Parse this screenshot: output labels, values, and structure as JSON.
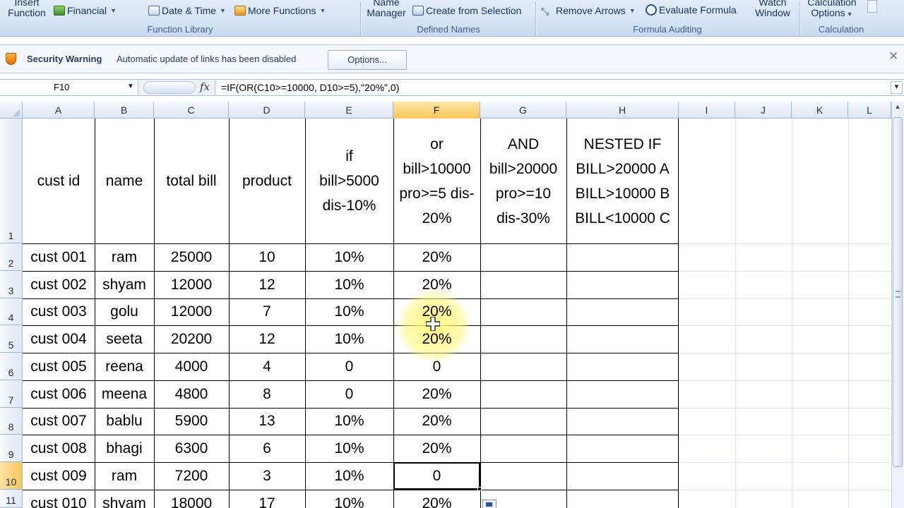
{
  "ribbon": {
    "insert_function": [
      "Insert",
      "Function"
    ],
    "financial": "Financial",
    "date_time": "Date & Time",
    "more_functions": "More Functions",
    "function_library": "Function Library",
    "name_manager": [
      "Name",
      "Manager"
    ],
    "create_from_selection": "Create from Selection",
    "defined_names": "Defined Names",
    "remove_arrows": "Remove Arrows",
    "evaluate_formula": "Evaluate Formula",
    "watch_window": [
      "Watch",
      "Window"
    ],
    "formula_auditing": "Formula Auditing",
    "calculation_options": [
      "Calculation",
      "Options"
    ],
    "calculation": "Calculation"
  },
  "security_bar": {
    "title": "Security Warning",
    "message": "Automatic update of links has been disabled",
    "options_button": "Options..."
  },
  "formula_bar": {
    "name_box": "F10",
    "fx": "fx",
    "formula": "=IF(OR(C10>=10000, D10>=5),\"20%\",0)"
  },
  "columns": [
    "A",
    "B",
    "C",
    "D",
    "E",
    "F",
    "G",
    "H",
    "I",
    "J",
    "K",
    "L"
  ],
  "selected_column": "F",
  "rows": [
    "1",
    "2",
    "3",
    "4",
    "5",
    "6",
    "7",
    "8",
    "9",
    "10",
    "11"
  ],
  "selected_row": "10",
  "header_row": {
    "A": [
      "cust id"
    ],
    "B": [
      "name"
    ],
    "C": [
      "total bill"
    ],
    "D": [
      "product"
    ],
    "E": [
      "if",
      "bill>5000",
      "dis-10%"
    ],
    "F": [
      "or",
      "bill>10000",
      "pro>=5 dis-",
      "20%"
    ],
    "G": [
      "AND",
      "bill>20000",
      "pro>=10",
      "dis-30%"
    ],
    "H": [
      "NESTED IF",
      "BILL>20000 A",
      "BILL>10000 B",
      "BILL<10000 C"
    ]
  },
  "table": [
    [
      "cust 001",
      "ram",
      "25000",
      "10",
      "10%",
      "20%"
    ],
    [
      "cust 002",
      "shyam",
      "12000",
      "12",
      "10%",
      "20%"
    ],
    [
      "cust 003",
      "golu",
      "12000",
      "7",
      "10%",
      "20%"
    ],
    [
      "cust 004",
      "seeta",
      "20200",
      "12",
      "10%",
      "20%"
    ],
    [
      "cust 005",
      "reena",
      "4000",
      "4",
      "0",
      "0"
    ],
    [
      "cust 006",
      "meena",
      "4800",
      "8",
      "0",
      "20%"
    ],
    [
      "cust 007",
      "bablu",
      "5900",
      "13",
      "10%",
      "20%"
    ],
    [
      "cust 008",
      "bhagi",
      "6300",
      "6",
      "10%",
      "20%"
    ],
    [
      "cust 009",
      "ram",
      "7200",
      "3",
      "10%",
      "0"
    ],
    [
      "cust 010",
      "shyam",
      "18000",
      "17",
      "10%",
      "20%"
    ]
  ],
  "icons": {
    "security": "shield-icon",
    "close": "close-icon",
    "cursor": "cell-cursor-icon",
    "paste_options": "paste-options-icon"
  },
  "colors": {
    "selected_header": "#f9c65c",
    "cursor_highlight": "#fff678",
    "ribbon": "#d5e3f4"
  }
}
